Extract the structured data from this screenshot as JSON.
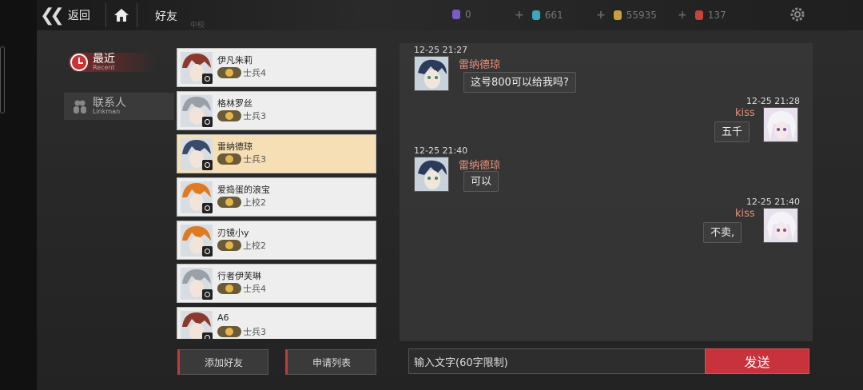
{
  "header": {
    "back_label": "返回",
    "title": "好友",
    "title_sub": "中校",
    "resources": [
      {
        "icon": "purple-gem-icon",
        "value": "0",
        "color": "#7a5cc8"
      },
      {
        "icon": "teal-crystal-icon",
        "value": "661",
        "color": "#3aa8b8"
      },
      {
        "icon": "gold-coin-icon",
        "value": "55935",
        "color": "#c8a040"
      },
      {
        "icon": "red-fuel-icon",
        "value": "137",
        "color": "#c8443a"
      }
    ]
  },
  "nav": {
    "recent_label": "最近",
    "recent_sub": "Recent",
    "contacts_label": "联系人",
    "contacts_sub": "Linkman"
  },
  "friends": [
    {
      "name": "伊凡朱莉",
      "rank": "士兵4",
      "selected": false,
      "avatar_color": "#8a3a2a"
    },
    {
      "name": "格林罗丝",
      "rank": "士兵3",
      "selected": false,
      "avatar_color": "#9aa0a8"
    },
    {
      "name": "雷纳德琼",
      "rank": "士兵3",
      "selected": true,
      "avatar_color": "#3a4a6a"
    },
    {
      "name": "爱捣蛋的浪宝",
      "rank": "上校2",
      "selected": false,
      "avatar_color": "#e07a20"
    },
    {
      "name": "刃镜小y",
      "rank": "上校2",
      "selected": false,
      "avatar_color": "#e07a20"
    },
    {
      "name": "行者伊芙琳",
      "rank": "士兵4",
      "selected": false,
      "avatar_color": "#9aa0a8"
    },
    {
      "name": "A6",
      "rank": "士兵3",
      "selected": false,
      "avatar_color": "#8a3a2a"
    }
  ],
  "chat": {
    "messages": [
      {
        "side": "left",
        "time": "12-25 21:27",
        "sender": "雷纳德琼",
        "text": "这号800可以给我吗?"
      },
      {
        "side": "right",
        "time": "12-25 21:28",
        "sender": "kiss",
        "text": "五千"
      },
      {
        "side": "left",
        "time": "12-25 21:40",
        "sender": "雷纳德琼",
        "text": "可以"
      },
      {
        "side": "right",
        "time": "12-25 21:40",
        "sender": "kiss",
        "text": "不卖,"
      }
    ]
  },
  "actions": {
    "add_friend": "添加好友",
    "apply_list": "申请列表",
    "input_placeholder": "输入文字(60字限制)",
    "send": "发送"
  }
}
